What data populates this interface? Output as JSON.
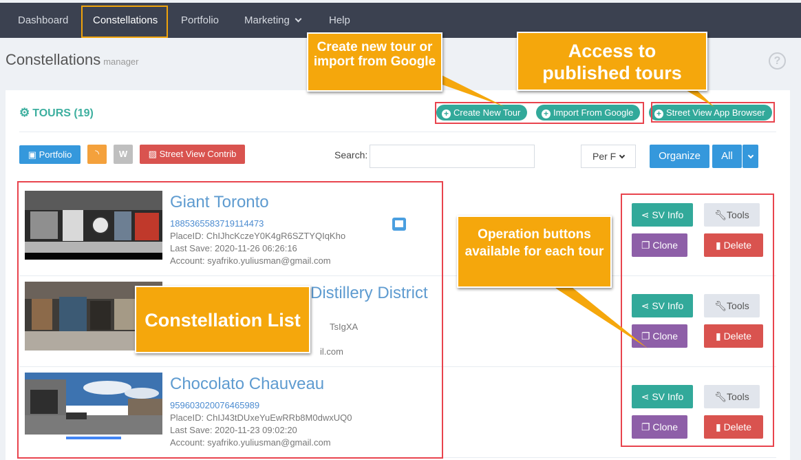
{
  "nav": {
    "dashboard": "Dashboard",
    "constellations": "Constellations",
    "portfolio": "Portfolio",
    "marketing": "Marketing",
    "help": "Help"
  },
  "page": {
    "title": "Constellations",
    "subtitle": "manager",
    "help": "?"
  },
  "tours": {
    "title": "TOURS (19)",
    "create_label": "Create New Tour",
    "import_label": "Import From Google",
    "browser_label": "Street View App Browser"
  },
  "toolbar": {
    "portfolio_label": "Portfolio",
    "contrib_label": "Street View Contrib",
    "search_label": "Search:",
    "search_value": "",
    "per_page_value": "Per F",
    "organize_label": "Organize",
    "all_label": "All"
  },
  "rows": [
    {
      "name": "Giant Toronto",
      "id": "1885365583719114473",
      "place_id": "PlaceID: ChIJhcKczeY0K4gR6SZTYQIqKho",
      "last_save": "Last Save: 2020-11-26 06:26:16",
      "account": "Account: syafriko.yuliusman@gmail.com"
    },
    {
      "name": "Distillery District",
      "id": "",
      "place_id": "TsIgXA",
      "last_save": "",
      "account": "il.com"
    },
    {
      "name": "Chocolato Chauveau",
      "id": "959603020076465989",
      "place_id": "PlaceID: ChIJ43tDUxeYuEwRRb8M0dwxUQ0",
      "last_save": "Last Save: 2020-11-23 09:02:20",
      "account": "Account: syafriko.yuliusman@gmail.com"
    }
  ],
  "ops": {
    "sv_info": "SV Info",
    "tools": "Tools",
    "clone": "Clone",
    "delete": "Delete"
  },
  "callouts": {
    "create": "Create new tour or import from Google",
    "access": "Access to published tours",
    "operations": "Operation buttons available for each tour",
    "list": "Constellation List"
  },
  "colors": {
    "nav_bg": "#3b4150",
    "teal": "#32a99a",
    "callout": "#f5a70c",
    "highlight": "#e8434d"
  }
}
